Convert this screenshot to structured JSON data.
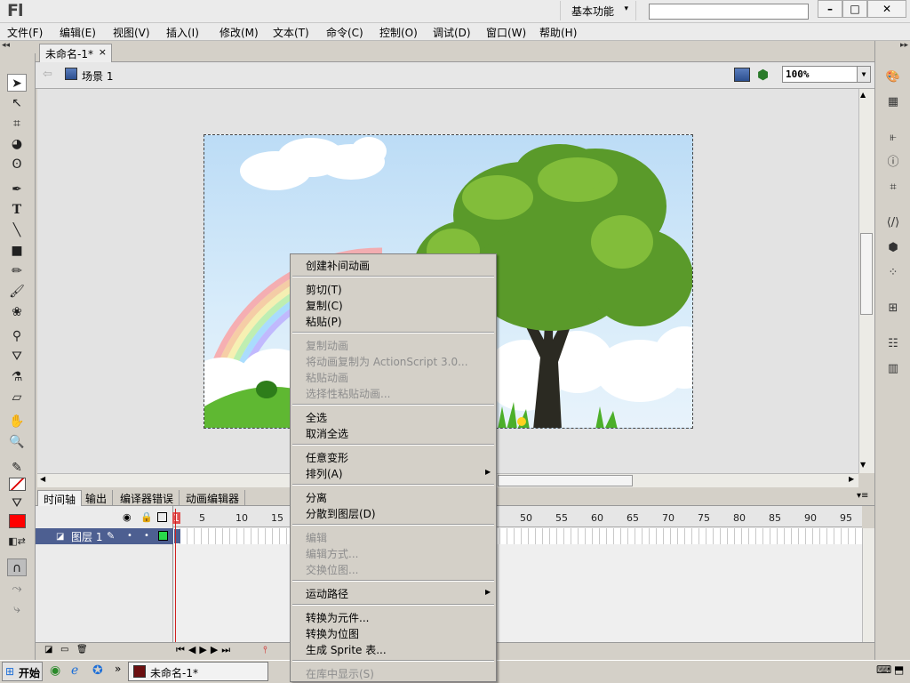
{
  "app": {
    "logo": "Fl",
    "workspace": "基本功能",
    "search_placeholder": ""
  },
  "window_controls": {
    "minimize": "–",
    "maximize": "□",
    "close": "✕"
  },
  "menubar": [
    "文件(F)",
    "编辑(E)",
    "视图(V)",
    "插入(I)",
    "修改(M)",
    "文本(T)",
    "命令(C)",
    "控制(O)",
    "调试(D)",
    "窗口(W)",
    "帮助(H)"
  ],
  "document": {
    "tab": "未命名-1*",
    "tab_close": "×",
    "scene": "场景 1",
    "zoom": "100%"
  },
  "panels_collapse": "◂◂",
  "timeline": {
    "tabs": [
      "时间轴",
      "输出",
      "编译器错误",
      "动画编辑器"
    ],
    "layer_name": "图层 1",
    "ruler": [
      "1",
      "5",
      "10",
      "15",
      "50",
      "55",
      "60",
      "65",
      "70",
      "75",
      "80",
      "85",
      "90",
      "95"
    ]
  },
  "context_menu": {
    "items": [
      {
        "label": "创建补间动画",
        "enabled": true
      },
      {
        "label": "剪切(T)",
        "enabled": true
      },
      {
        "label": "复制(C)",
        "enabled": true
      },
      {
        "label": "粘贴(P)",
        "enabled": true
      },
      {
        "label": "复制动画",
        "enabled": false
      },
      {
        "label": "将动画复制为 ActionScript 3.0...",
        "enabled": false
      },
      {
        "label": "粘贴动画",
        "enabled": false
      },
      {
        "label": "选择性粘贴动画...",
        "enabled": false
      },
      {
        "label": "全选",
        "enabled": true
      },
      {
        "label": "取消全选",
        "enabled": true
      },
      {
        "label": "任意变形",
        "enabled": true
      },
      {
        "label": "排列(A)",
        "enabled": true,
        "submenu": true
      },
      {
        "label": "分离",
        "enabled": true
      },
      {
        "label": "分散到图层(D)",
        "enabled": true
      },
      {
        "label": "编辑",
        "enabled": false
      },
      {
        "label": "编辑方式...",
        "enabled": false
      },
      {
        "label": "交换位图...",
        "enabled": false
      },
      {
        "label": "运动路径",
        "enabled": true,
        "submenu": true
      },
      {
        "label": "转换为元件...",
        "enabled": true
      },
      {
        "label": "转换为位图",
        "enabled": true
      },
      {
        "label": "生成 Sprite 表...",
        "enabled": true
      },
      {
        "label": "在库中显示(S)",
        "enabled": false
      }
    ]
  },
  "taskbar": {
    "start": "开始",
    "task": "未命名-1*",
    "chevron": "»"
  },
  "colors": {
    "stroke": "#000000",
    "fill": "#ff0000",
    "layer_highlight": "#4d5f91",
    "accent": "#c0392b"
  }
}
